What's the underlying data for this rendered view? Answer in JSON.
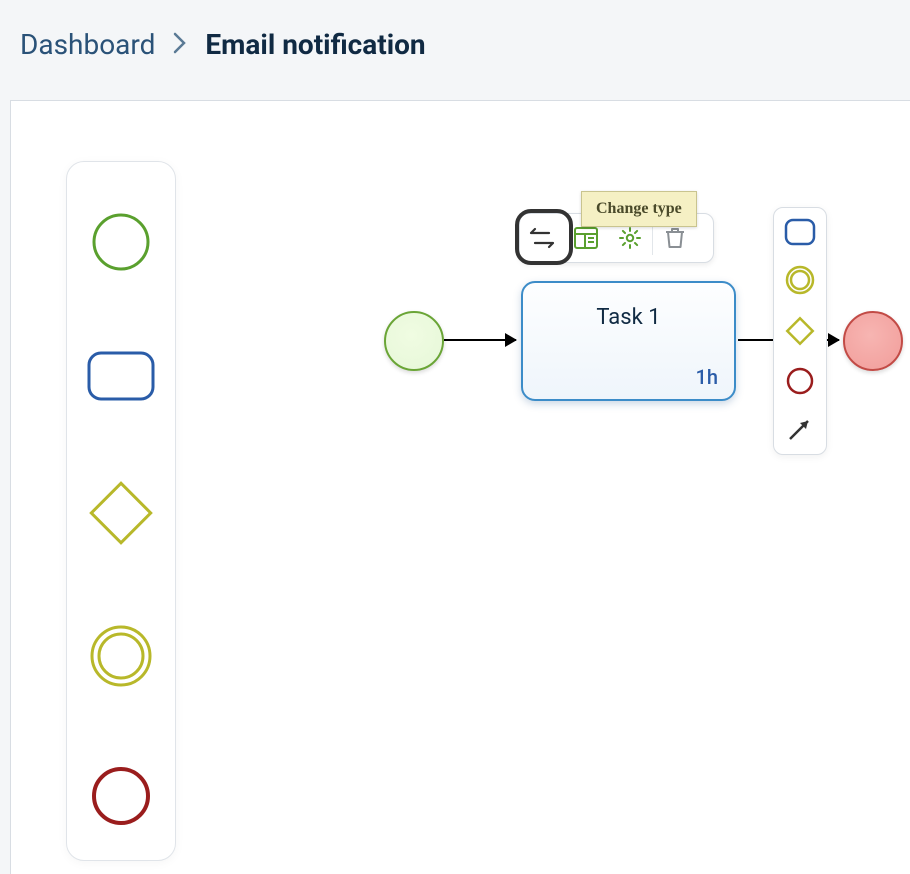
{
  "breadcrumb": {
    "root": "Dashboard",
    "current": "Email notification"
  },
  "palette": {
    "items": [
      {
        "name": "start-event",
        "color": "#5aa02e"
      },
      {
        "name": "task",
        "color": "#2a5ca8"
      },
      {
        "name": "gateway",
        "color": "#b8b82a"
      },
      {
        "name": "intermediate-event",
        "color": "#b8b82a"
      },
      {
        "name": "end-event",
        "color": "#9a1d1d"
      }
    ]
  },
  "diagram": {
    "start": {
      "label": ""
    },
    "task": {
      "label": "Task 1",
      "duration": "1h"
    },
    "end": {
      "label": ""
    }
  },
  "context_toolbar": {
    "items": [
      {
        "name": "change-type",
        "icon": "swap"
      },
      {
        "name": "edit-form",
        "icon": "form",
        "color": "#5aa02e"
      },
      {
        "name": "settings",
        "icon": "gear",
        "color": "#5aa02e"
      },
      {
        "name": "delete",
        "icon": "trash",
        "color": "#8a8f94"
      }
    ],
    "tooltip": "Change type"
  },
  "mini_palette": {
    "items": [
      {
        "name": "task",
        "shape": "rounded-rect",
        "color": "#2a5ca8"
      },
      {
        "name": "intermediate-event",
        "shape": "double-circle",
        "color": "#b8b82a"
      },
      {
        "name": "gateway",
        "shape": "diamond",
        "color": "#b8b82a"
      },
      {
        "name": "end-event",
        "shape": "circle",
        "color": "#9a1d1d"
      },
      {
        "name": "connector",
        "shape": "arrow",
        "color": "#333"
      }
    ]
  }
}
